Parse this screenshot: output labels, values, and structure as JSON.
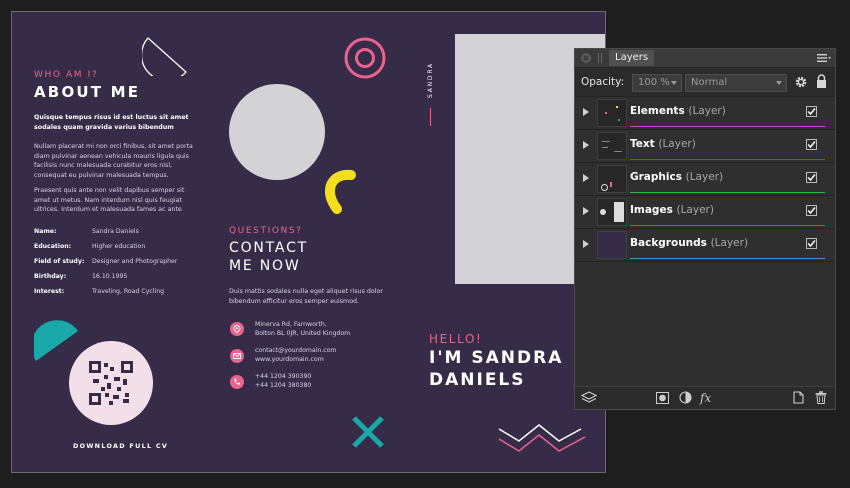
{
  "document": {
    "left_column": {
      "eyebrow": "WHO AM I?",
      "heading": "ABOUT ME",
      "lead": "Quisque tempus risus id est luctus sit amet sodales quam gravida varius bibendum",
      "paragraph_1": "Nullam placerat mi non orci finibus, sit amet porta diam pulvinar aenean vehicula mauris ligula quis facilisis nunc malesuada curabitur eros nisl, consequat eu pulvinar malesuada tempus.",
      "paragraph_2": "Praesent quis ante non velit dapibus semper sit amet ut metus. Nam interdum nisl quis feugiat ultrices. Interdum et malesuada fames ac ante",
      "info": [
        {
          "key": "Name:",
          "value": "Sandra Daniels"
        },
        {
          "key": "Education:",
          "value": "Higher education"
        },
        {
          "key": "Field of study:",
          "value": "Designer and Photographer"
        },
        {
          "key": "Birthday:",
          "value": "16.10.1995"
        },
        {
          "key": "Interest:",
          "value": "Traveling, Road Cycling"
        }
      ],
      "download_label": "DOWNLOAD FULL CV"
    },
    "middle_column": {
      "eyebrow": "QUESTIONS?",
      "heading_line1": "CONTACT",
      "heading_line2": "ME NOW",
      "body": "Duis mattis sodales nulla eget aliquet risus dolor bibendum efficitur eros semper euismod.",
      "address_line1": "Minerva Rd, Farnworth,",
      "address_line2": "Bolton BL 0JR, United Kingdom",
      "email": "contact@yourdomain.com",
      "website": "www.yourdomain.com",
      "phone_1": "+44 1204 390390",
      "phone_2": "+44 1204 380380"
    },
    "right_column": {
      "vertical_name": "SANDRA",
      "eyebrow": "HELLO!",
      "heading_line1": "I'M SANDRA",
      "heading_line2": "DANIELS"
    },
    "colors": {
      "background": "#362c48",
      "accent_pink": "#e8648c",
      "accent_yellow": "#f4df1e",
      "accent_teal": "#1aa8a8",
      "placeholder_gray": "#d3d3d6"
    }
  },
  "layers_panel": {
    "tab_label": "Layers",
    "opacity_label": "Opacity:",
    "opacity_value": "100 %",
    "blend_mode": "Normal",
    "layers": [
      {
        "name": "Elements",
        "type": "(Layer)",
        "color": "#c04cd6",
        "visible": true
      },
      {
        "name": "Text",
        "type": "(Layer)",
        "color": "#3b55d9",
        "visible": true
      },
      {
        "name": "Graphics",
        "type": "(Layer)",
        "color": "#2fb84a",
        "visible": true
      },
      {
        "name": "Images",
        "type": "(Layer)",
        "color": "#d63a3a",
        "visible": true
      },
      {
        "name": "Backgrounds",
        "type": "(Layer)",
        "color": "#4a8fd6",
        "visible": true
      }
    ],
    "icons": {
      "close": "close-icon",
      "menu": "menu-icon",
      "settings": "gear-icon",
      "lock": "lock-icon",
      "layers": "layers-icon",
      "mask": "mask-icon",
      "adjustment": "adjustment-icon",
      "fx": "fx-icon",
      "new_layer": "new-layer-icon",
      "delete": "trash-icon"
    }
  }
}
